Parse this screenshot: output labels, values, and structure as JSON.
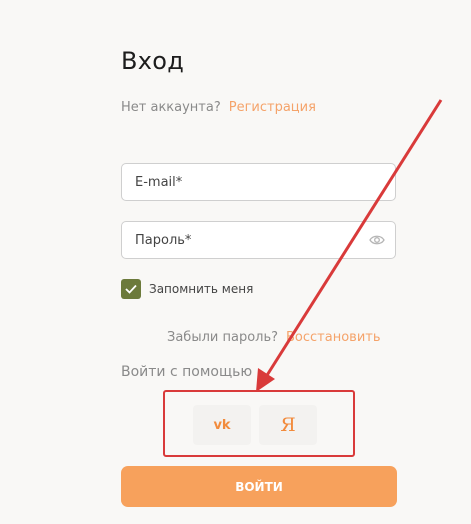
{
  "login": {
    "title": "Вход",
    "no_account_text": "Нет аккаунта?",
    "register_link": "Регистрация",
    "email_placeholder": "E-mail*",
    "password_placeholder": "Пароль*",
    "remember_label": "Запомнить меня",
    "forgot_text": "Забыли пароль?",
    "restore_link": "Восстановить",
    "login_via": "Войти с помощью",
    "vk_label": "vk",
    "yandex_label": "Я",
    "submit_label": "ВОЙТИ"
  },
  "colors": {
    "accent": "#f7a15c",
    "link": "#f5a36a",
    "checkbox": "#6c7a3b",
    "annotation": "#d93a3a"
  }
}
